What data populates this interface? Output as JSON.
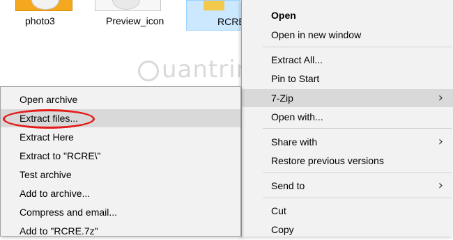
{
  "files": [
    {
      "label": "photo3"
    },
    {
      "label": "Preview_icon"
    },
    {
      "label": "RCRE"
    }
  ],
  "watermark": "uantrimang",
  "context_menu": {
    "items": [
      {
        "label": "Open"
      },
      {
        "label": "Open in new window"
      },
      {
        "label": "Extract All..."
      },
      {
        "label": "Pin to Start"
      },
      {
        "label": "7-Zip"
      },
      {
        "label": "Open with..."
      },
      {
        "label": "Share with"
      },
      {
        "label": "Restore previous versions"
      },
      {
        "label": "Send to"
      },
      {
        "label": "Cut"
      },
      {
        "label": "Copy"
      }
    ],
    "chevron": "›"
  },
  "submenu_7zip": {
    "items": [
      {
        "label": "Open archive"
      },
      {
        "label": "Extract files..."
      },
      {
        "label": "Extract Here"
      },
      {
        "label": "Extract to \"RCRE\\\""
      },
      {
        "label": "Test archive"
      },
      {
        "label": "Add to archive..."
      },
      {
        "label": "Compress and email..."
      },
      {
        "label": "Add to \"RCRE.7z\""
      }
    ]
  },
  "colors": {
    "highlight": "#d9d9d9",
    "selection": "#cce8ff",
    "annotation": "#e41b1b"
  }
}
